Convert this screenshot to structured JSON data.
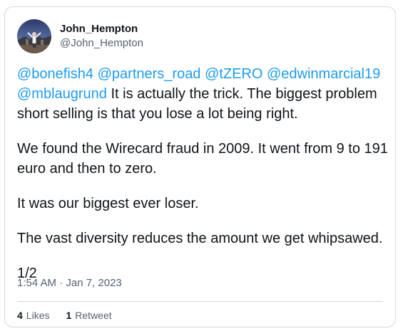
{
  "author": {
    "display_name": "John_Hempton",
    "handle": "@John_Hempton"
  },
  "tweet": {
    "mentions": [
      "@bonefish4",
      "@partners_road",
      "@tZERO",
      "@edwinmarcial19",
      "@mblaugrund"
    ],
    "paragraph1_text": "It is actually the trick. The biggest problem short selling is that you lose a lot being right.",
    "paragraph2": "We found the Wirecard fraud in 2009. It went from 9 to 191 euro and then to zero.",
    "paragraph3": "It was our biggest ever loser.",
    "paragraph4": "The vast diversity reduces the amount we get whipsawed.",
    "paragraph5": "1/2",
    "timestamp": "1:54 AM · Jan 7, 2023"
  },
  "stats": {
    "likes_count": "4",
    "likes_label": "Likes",
    "retweets_count": "1",
    "retweets_label": "Retweet"
  }
}
